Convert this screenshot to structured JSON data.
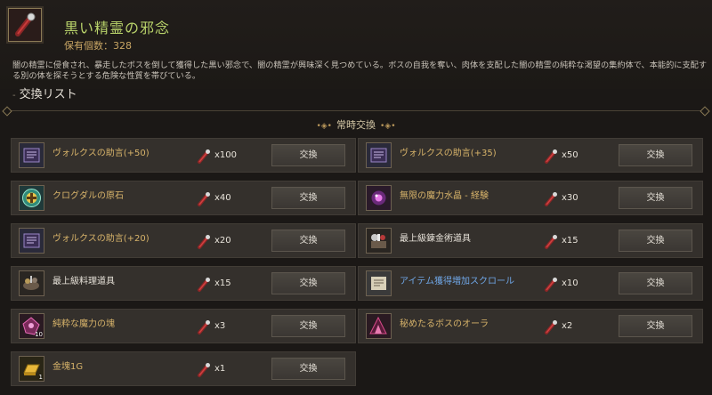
{
  "header": {
    "title": "黒い精霊の邪念",
    "owned": "保有個数：328",
    "description": "闇の精霊に侵食され、暴走したボスを倒して獲得した黒い邪念で、闇の精霊が興味深く見つめている。ボスの自我を奪い、肉体を支配した闇の精霊の純粋な渇望の集約体で、本能的に支配する別の体を探そうとする危険な性質を帯びている。",
    "list_title": "交換リスト"
  },
  "section": {
    "title": "常時交換",
    "left_ornament": "•◈•",
    "right_ornament": "•◈•"
  },
  "button_label": "交換",
  "items": [
    {
      "name": "ヴォルクスの助言(+50)",
      "cost": "x100",
      "icon": "scroll-icon",
      "color": "#d7b36a"
    },
    {
      "name": "ヴォルクスの助言(+35)",
      "cost": "x50",
      "icon": "scroll-icon",
      "color": "#d7b36a"
    },
    {
      "name": "クログダルの原石",
      "cost": "x40",
      "icon": "gem-cross-icon",
      "color": "#d7b36a"
    },
    {
      "name": "無限の魔力水晶 - 経験",
      "cost": "x30",
      "icon": "crystal-icon",
      "color": "#d7b36a"
    },
    {
      "name": "ヴォルクスの助言(+20)",
      "cost": "x20",
      "icon": "scroll-icon",
      "color": "#d7b36a"
    },
    {
      "name": "最上級錬金術道具",
      "cost": "x15",
      "icon": "alchemy-tools-icon",
      "color": "#e6e1d8"
    },
    {
      "name": "最上級料理道具",
      "cost": "x15",
      "icon": "cooking-tools-icon",
      "color": "#e6e1d8"
    },
    {
      "name": "アイテム獲得増加スクロール",
      "cost": "x10",
      "icon": "paper-scroll-icon",
      "color": "#6fa6e6"
    },
    {
      "name": "純粋な魔力の塊",
      "cost": "x3",
      "icon": "magic-chunk-icon",
      "color": "#d7b36a",
      "qty": "10"
    },
    {
      "name": "秘めたるボスのオーラ",
      "cost": "x2",
      "icon": "aura-icon",
      "color": "#d7b36a"
    },
    {
      "name": "金塊1G",
      "cost": "x1",
      "icon": "gold-bar-icon",
      "color": "#d7b36a",
      "qty": "1"
    }
  ]
}
